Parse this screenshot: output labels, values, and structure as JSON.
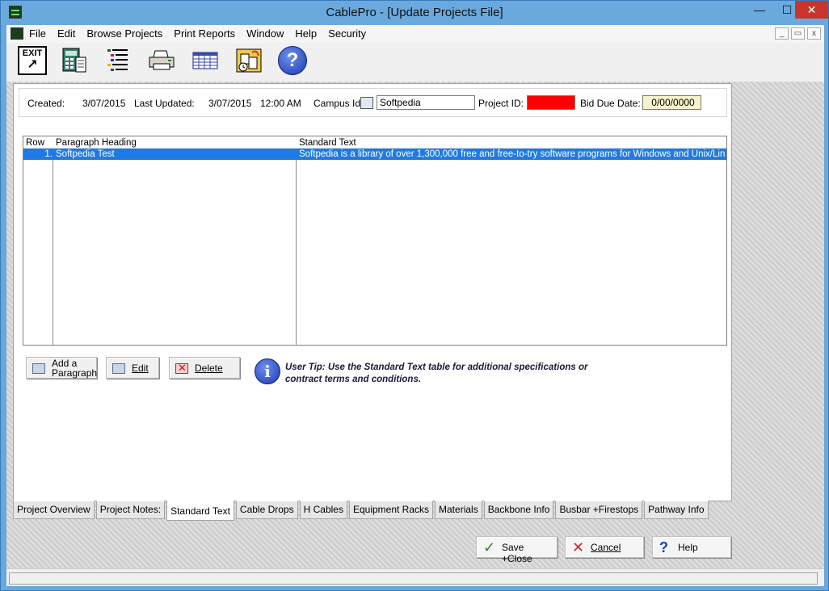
{
  "window": {
    "title": "CablePro - [Update Projects File]",
    "controls": {
      "minimize": "—",
      "maximize": "☐",
      "close": "✕"
    }
  },
  "menu": {
    "items": [
      "File",
      "Edit",
      "Browse Projects",
      "Print Reports",
      "Window",
      "Help",
      "Security"
    ],
    "mdi_controls": [
      "_",
      "▭",
      "x"
    ]
  },
  "toolbar": {
    "exit_label": "EXIT",
    "exit_arrow": "↗",
    "help_label": "?",
    "icons": [
      "exit-icon",
      "calculator-icon",
      "list-icon",
      "printer-icon",
      "spreadsheet-icon",
      "calendar-icon",
      "help-icon"
    ]
  },
  "project_info": {
    "created_label": "Created:",
    "created_value": "3/07/2015",
    "last_updated_label": "Last Updated:",
    "last_updated_date": "3/07/2015",
    "last_updated_time": "12:00 AM",
    "campus_id_label": "Campus Id:",
    "campus_id_value": "Softpedia",
    "project_id_label": "Project ID:",
    "project_id_value": "",
    "bid_due_label": "Bid Due Date:",
    "bid_due_value": "0/00/0000"
  },
  "table": {
    "columns": [
      "Row",
      "Paragraph Heading",
      "Standard Text"
    ],
    "rows": [
      {
        "row": "1.",
        "heading": "Softpedia Test",
        "text": "Softpedia is a library of over 1,300,000 free and free-to-try software programs for Windows and Unix/Linux, games"
      }
    ]
  },
  "actions": {
    "add_paragraph_line1": "Add a",
    "add_paragraph_line2": "Paragraph",
    "edit": "Edit",
    "delete": "Delete"
  },
  "tip": {
    "icon": "i",
    "text": "User Tip: Use the Standard Text table for additional specifications or contract terms and conditions."
  },
  "tabs": [
    "Project Overview",
    "Project Notes:",
    "Standard Text",
    "Cable Drops",
    "H Cables",
    "Equipment Racks",
    "Materials",
    "Backbone Info",
    "Busbar +Firestops",
    "Pathway Info"
  ],
  "active_tab": "Standard Text",
  "buttons": {
    "save_close": "Save +Close",
    "cancel": "Cancel",
    "help": "Help"
  },
  "colors": {
    "titlebar": "#6aa9dd",
    "selection": "#1f7ae5",
    "project_id_field": "#ff0000",
    "bid_due_field": "#f5f2cc"
  }
}
